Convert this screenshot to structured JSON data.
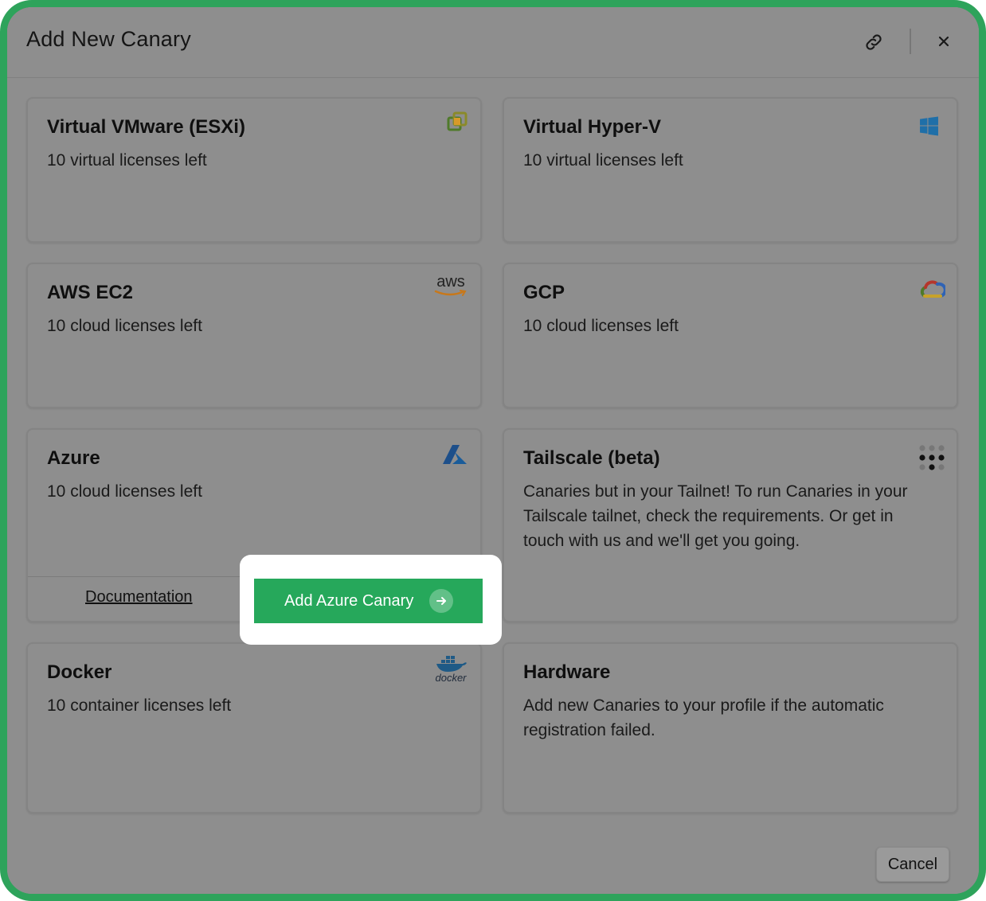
{
  "modal": {
    "title": "Add New Canary",
    "cancel_label": "Cancel",
    "link_icon": "link-icon",
    "close_icon": "close-icon"
  },
  "cards": {
    "vmware": {
      "title": "Virtual VMware (ESXi)",
      "desc": "10 virtual licenses left",
      "icon": "vmware-icon"
    },
    "hyperv": {
      "title": "Virtual Hyper-V",
      "desc": "10 virtual licenses left",
      "icon": "windows-icon"
    },
    "aws": {
      "title": "AWS EC2",
      "desc": "10 cloud licenses left",
      "icon": "aws-icon",
      "icon_text": "aws"
    },
    "gcp": {
      "title": "GCP",
      "desc": "10 cloud licenses left",
      "icon": "google-cloud-icon"
    },
    "azure": {
      "title": "Azure",
      "desc": "10 cloud licenses left",
      "icon": "azure-icon",
      "doc_link": "Documentation",
      "button_label": "Add Azure Canary"
    },
    "tailscale": {
      "title": "Tailscale (beta)",
      "desc": "Canaries but in your Tailnet! To run Canaries in your Tailscale tailnet, check the requirements. Or get in touch with us and we'll get you going.",
      "icon": "tailscale-icon"
    },
    "docker": {
      "title": "Docker",
      "desc": "10 container licenses left",
      "icon": "docker-icon",
      "icon_text": "docker"
    },
    "hardware": {
      "title": "Hardware",
      "desc": "Add new Canaries to your profile if the automatic registration failed."
    }
  },
  "colors": {
    "accent_green": "#26a85b",
    "frame_green": "#2ea35b",
    "overlay_gray": "#8e8e8e"
  }
}
